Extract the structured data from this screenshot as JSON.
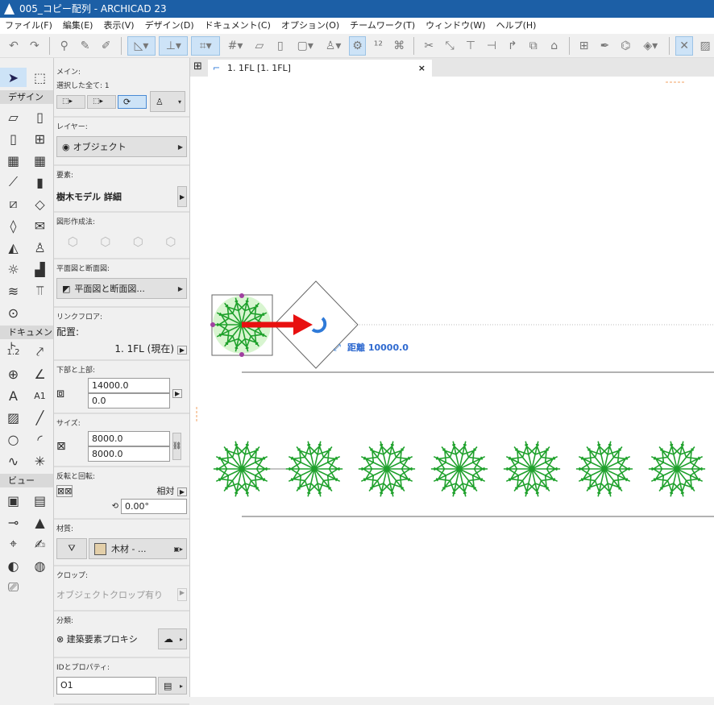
{
  "window": {
    "title": "005_コピー配列 - ARCHICAD 23"
  },
  "menu": [
    "ファイル(F)",
    "編集(E)",
    "表示(V)",
    "デザイン(D)",
    "ドキュメント(C)",
    "オプション(O)",
    "チームワーク(T)",
    "ウィンドウ(W)",
    "ヘルプ(H)"
  ],
  "toolbox": {
    "design": "デザイン",
    "document": "ドキュメント",
    "view": "ビュー",
    "a1": "A1",
    "dim": "1.2"
  },
  "info": {
    "main_label": "メイン:",
    "selected": "選択した全て: 1",
    "layer_label": "レイヤー:",
    "layer_value": "オブジェクト",
    "element_label": "要素:",
    "element_value": "樹木モデル 詳細",
    "geometry_label": "図形作成法:",
    "plan_label": "平面図と断面図:",
    "plan_value": "平面図と断面図...",
    "link_label": "リンクフロア:",
    "placement_label": "配置:",
    "placement_value": "1. 1FL (現在)",
    "bottom_top_label": "下部と上部:",
    "top_value": "14000.0",
    "bottom_value": "0.0",
    "size_label": "サイズ:",
    "width_value": "8000.0",
    "depth_value": "8000.0",
    "rotate_label": "反転と回転:",
    "relative": "相対",
    "angle": "0.00°",
    "material_label": "材質:",
    "material_value": "木材 - ...",
    "material_color": "#e3cfa9",
    "crop_label": "クロップ:",
    "crop_value": "オブジェクトクロップ有り",
    "class_label": "分類:",
    "class_value": "建築要素プロキシ",
    "id_label": "IDとプロパティ:",
    "id_value": "O1"
  },
  "tab": {
    "label": "1. 1FL [1. 1FL]",
    "close": "×"
  },
  "canvas": {
    "distance_label": "距離 10000.0",
    "tree_count": 7,
    "tree_color": "#1fa12c",
    "arrow_color": "#e81010",
    "accent": "#2f7ad8"
  }
}
